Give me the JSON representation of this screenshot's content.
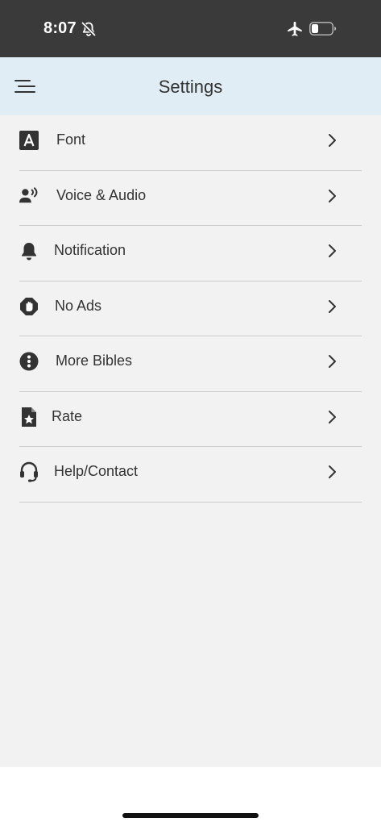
{
  "status_bar": {
    "time": "8:07",
    "icons": [
      "bell-slash-icon",
      "airplane-icon",
      "battery-icon"
    ]
  },
  "header": {
    "title": "Settings",
    "menu_icon": "menu-icon"
  },
  "settings": {
    "items": [
      {
        "label": "Font",
        "icon": "font-icon"
      },
      {
        "label": "Voice & Audio",
        "icon": "voice-icon"
      },
      {
        "label": "Notification",
        "icon": "bell-icon"
      },
      {
        "label": "No Ads",
        "icon": "hand-stop-icon"
      },
      {
        "label": "More Bibles",
        "icon": "more-icon"
      },
      {
        "label": "Rate",
        "icon": "star-file-icon"
      },
      {
        "label": "Help/Contact",
        "icon": "headset-icon"
      }
    ]
  },
  "colors": {
    "status_bar": "#3a3a3a",
    "header": "#e1edf5",
    "content": "#f2f2f2",
    "text": "#333333",
    "divider": "#cccccc"
  }
}
